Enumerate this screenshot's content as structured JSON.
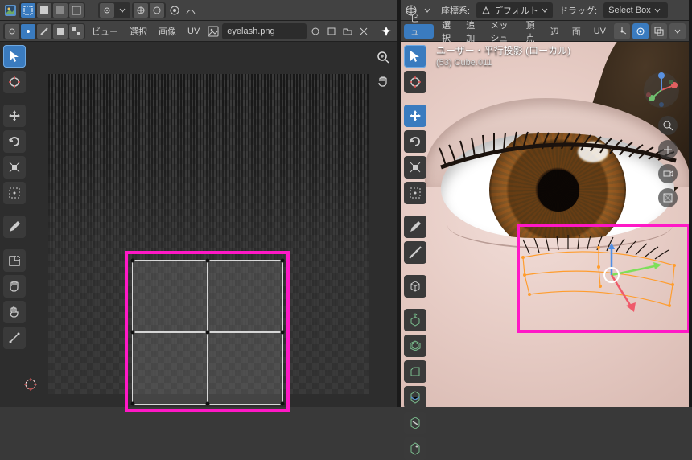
{
  "uv_header": {
    "image_dropdown_icon": "image",
    "file_icon": "picture",
    "filename": "eyelash.png",
    "menus": {
      "view": "ビュー",
      "select": "選択",
      "image": "画像",
      "uv": "UV"
    }
  },
  "view3d_header": {
    "orient_label": "座標系:",
    "orient_value": "デフォルト",
    "drag_label": "ドラッグ:",
    "drag_value": "Select Box"
  },
  "view3d_sub": {
    "view": "ビュー",
    "select": "選択",
    "add": "追加",
    "mesh": "メッシュ",
    "vertex": "頂点",
    "edge": "辺",
    "face": "面",
    "uv": "UV"
  },
  "overlay_info": {
    "line1": "ユーザー・平行投影 (ローカル)",
    "line2": "(53) Cube.011"
  },
  "colors": {
    "highlight_pink": "#ff18c6",
    "blender_blue": "#3a7bbf"
  }
}
